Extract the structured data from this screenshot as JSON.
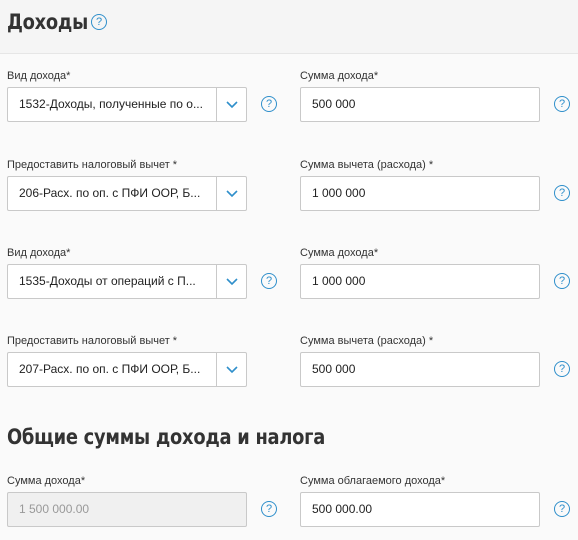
{
  "header": {
    "title": "Доходы"
  },
  "rows": [
    {
      "left_label": "Вид дохода*",
      "left_value": "1532-Доходы, полученные по о...",
      "right_label": "Сумма дохода*",
      "right_value": "500 000"
    },
    {
      "left_label": "Предоставить налоговый вычет *",
      "left_value": "206-Расх. по оп. с ПФИ ООР, Б...",
      "right_label": "Сумма вычета (расхода) *",
      "right_value": "1 000 000"
    },
    {
      "left_label": "Вид дохода*",
      "left_value": "1535-Доходы от операций с П...",
      "right_label": "Сумма дохода*",
      "right_value": "1 000 000"
    },
    {
      "left_label": "Предоставить налоговый вычет *",
      "left_value": "207-Расх. по оп. с ПФИ ООР, Б...",
      "right_label": "Сумма вычета (расхода) *",
      "right_value": "500 000"
    }
  ],
  "totals": {
    "title": "Общие суммы дохода и налога",
    "income_label": "Сумма дохода*",
    "income_value": "1 500 000.00",
    "taxable_label": "Сумма облагаемого дохода*",
    "taxable_value": "500 000.00"
  },
  "help_glyph": "?",
  "colors": {
    "accent": "#2f8fcb",
    "border": "#c9c9c9",
    "disabled_bg": "#f0f0f0"
  }
}
